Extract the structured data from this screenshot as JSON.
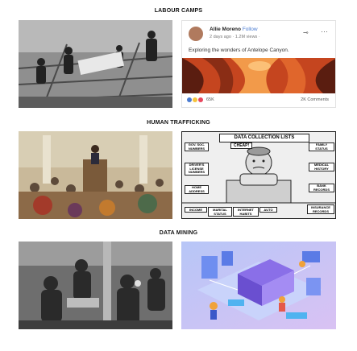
{
  "sections": [
    {
      "title": "LABOUR CAMPS"
    },
    {
      "title": "HUMAN TRAFFICKING"
    },
    {
      "title": "DATA MINING"
    }
  ],
  "post": {
    "author": "Allie Moreno",
    "follow": "Follow",
    "meta": "2 days ago · 1.2M views ·",
    "text": "Exploring the wonders of Antelope Canyon.",
    "reactions_count": "65K",
    "comments": "2K Comments"
  },
  "cartoon": {
    "banner": "DATA COLLECTION LISTS",
    "cheap": "CHEAP!",
    "labels": [
      "GOV. SOC. NUMBERS",
      "DRIVER'S LICENSE NUMBERS",
      "HOME ADDRESS",
      "FAMILY STATUS",
      "MEDICAL HISTORY",
      "BANK RECORDS",
      "INCOME",
      "MARITAL STATUS",
      "INTERNET HABITS",
      "AUTO",
      "INSURANCE RECORDS"
    ]
  },
  "colors": {
    "facebook_blue": "#4a7bd1",
    "canyon_orange": "#e0662c",
    "iso_purple": "#8a6fe8"
  }
}
